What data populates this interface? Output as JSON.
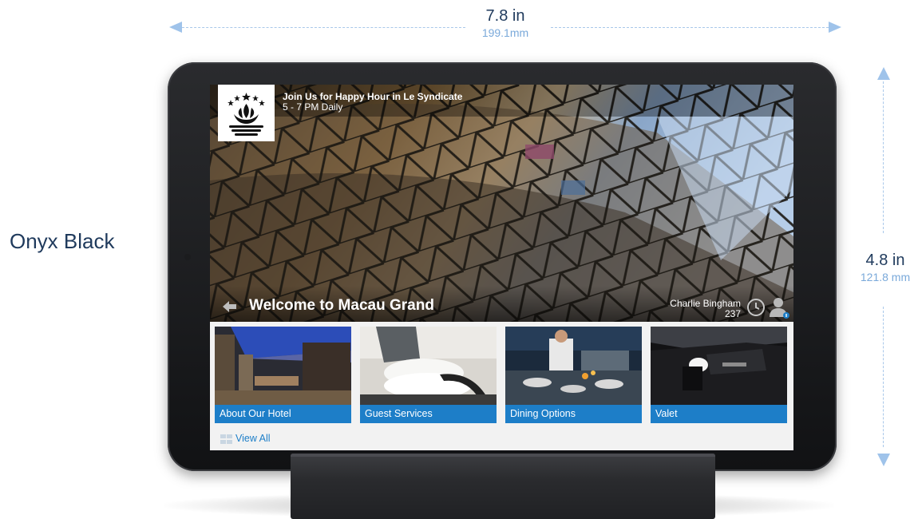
{
  "dimensions": {
    "width_in": "7.8 in",
    "width_mm": "199.1mm",
    "height_in": "4.8 in",
    "height_mm": "121.8 mm"
  },
  "color_name": "Onyx Black",
  "app": {
    "logo_icon": "lotus-emblem-icon",
    "promo": {
      "title": "Join Us for Happy Hour in Le Syndicate",
      "subtitle": "5 - 7 PM Daily"
    },
    "welcome_title": "Welcome to Macau Grand",
    "guest": {
      "name": "Charlie Bingham",
      "room": "237"
    },
    "tiles": [
      {
        "label": "About Our Hotel",
        "icon": "hotel-lobby-photo"
      },
      {
        "label": "Guest Services",
        "icon": "housekeeping-photo"
      },
      {
        "label": "Dining Options",
        "icon": "kitchen-photo"
      },
      {
        "label": "Valet",
        "icon": "car-door-photo"
      }
    ],
    "view_all_label": "View All",
    "accent_color": "#1d7ec8"
  }
}
